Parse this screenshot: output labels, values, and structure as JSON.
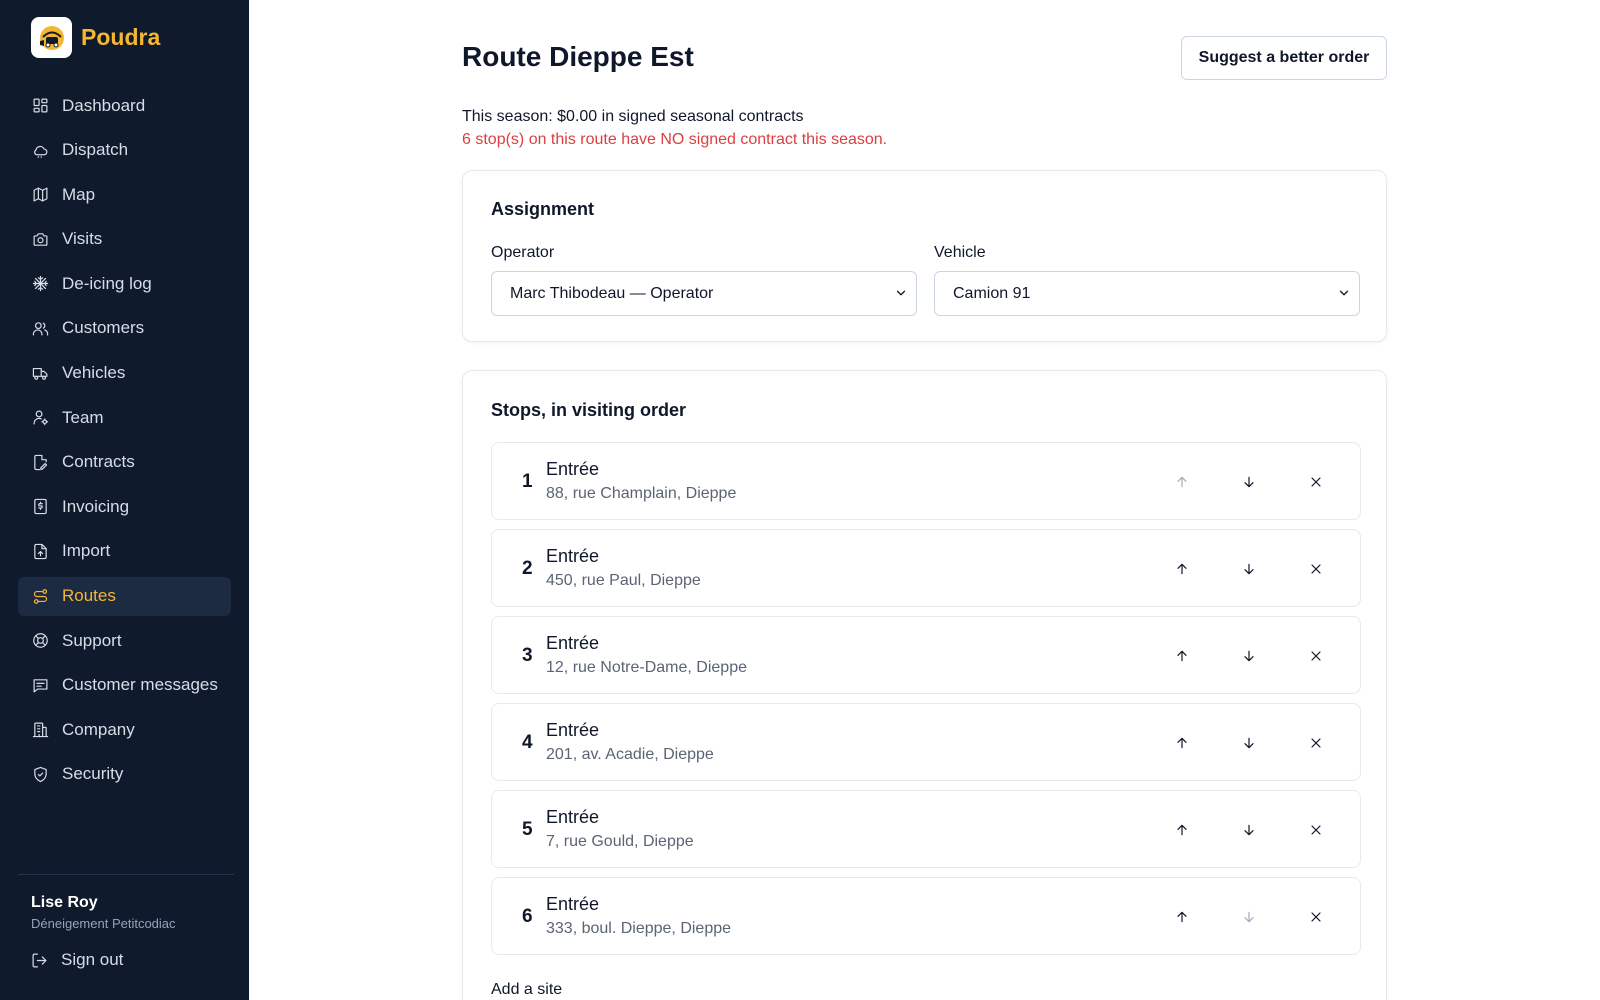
{
  "brand": {
    "name": "Poudra"
  },
  "sidebar": {
    "items": [
      {
        "label": "Dashboard",
        "icon": "dashboard-icon",
        "active": false
      },
      {
        "label": "Dispatch",
        "icon": "cloud-icon",
        "active": false
      },
      {
        "label": "Map",
        "icon": "map-icon",
        "active": false
      },
      {
        "label": "Visits",
        "icon": "camera-icon",
        "active": false
      },
      {
        "label": "De-icing log",
        "icon": "snowflake-icon",
        "active": false
      },
      {
        "label": "Customers",
        "icon": "users-icon",
        "active": false
      },
      {
        "label": "Vehicles",
        "icon": "truck-icon",
        "active": false
      },
      {
        "label": "Team",
        "icon": "user-cog-icon",
        "active": false
      },
      {
        "label": "Contracts",
        "icon": "file-edit-icon",
        "active": false
      },
      {
        "label": "Invoicing",
        "icon": "receipt-icon",
        "active": false
      },
      {
        "label": "Import",
        "icon": "file-upload-icon",
        "active": false
      },
      {
        "label": "Routes",
        "icon": "route-icon",
        "active": true
      },
      {
        "label": "Support",
        "icon": "life-buoy-icon",
        "active": false
      },
      {
        "label": "Customer messages",
        "icon": "message-icon",
        "active": false
      },
      {
        "label": "Company",
        "icon": "building-icon",
        "active": false
      },
      {
        "label": "Security",
        "icon": "shield-icon",
        "active": false
      }
    ],
    "user": {
      "name": "Lise Roy",
      "company": "Déneigement Petitcodiac"
    },
    "signout_label": "Sign out"
  },
  "page": {
    "title": "Route Dieppe Est",
    "suggest_label": "Suggest a better order",
    "season_text": "This season: $0.00 in signed seasonal contracts",
    "warning_text": "6 stop(s) on this route have NO signed contract this season."
  },
  "assignment": {
    "title": "Assignment",
    "operator_label": "Operator",
    "operator_value": "Marc Thibodeau — Operator",
    "vehicle_label": "Vehicle",
    "vehicle_value": "Camion 91"
  },
  "stops": {
    "title": "Stops, in visiting order",
    "items": [
      {
        "num": "1",
        "name": "Entrée",
        "address": "88, rue Champlain, Dieppe",
        "up_disabled": true,
        "down_disabled": false
      },
      {
        "num": "2",
        "name": "Entrée",
        "address": "450, rue Paul, Dieppe",
        "up_disabled": false,
        "down_disabled": false
      },
      {
        "num": "3",
        "name": "Entrée",
        "address": "12, rue Notre-Dame, Dieppe",
        "up_disabled": false,
        "down_disabled": false
      },
      {
        "num": "4",
        "name": "Entrée",
        "address": "201, av. Acadie, Dieppe",
        "up_disabled": false,
        "down_disabled": false
      },
      {
        "num": "5",
        "name": "Entrée",
        "address": "7, rue Gould, Dieppe",
        "up_disabled": false,
        "down_disabled": false
      },
      {
        "num": "6",
        "name": "Entrée",
        "address": "333, boul. Dieppe, Dieppe",
        "up_disabled": false,
        "down_disabled": true
      }
    ],
    "add_site_label": "Add a site"
  },
  "colors": {
    "sidebar_bg": "#0f1b2d",
    "accent": "#f5b731",
    "warning": "#dc3f3f"
  }
}
